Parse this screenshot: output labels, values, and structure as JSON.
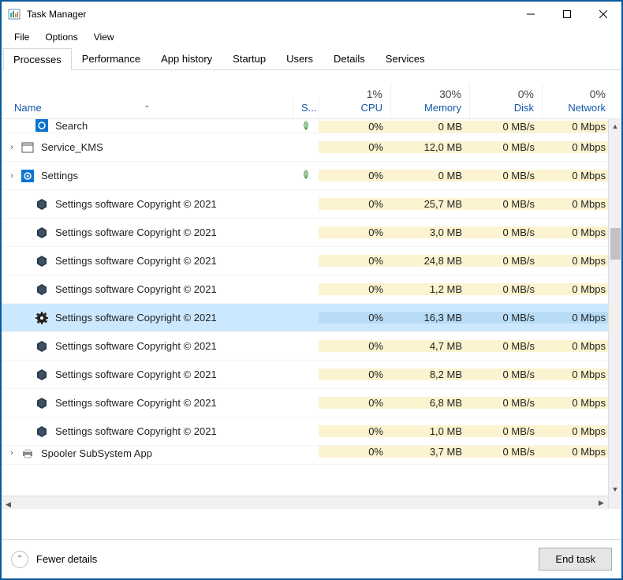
{
  "window": {
    "title": "Task Manager"
  },
  "menubar": [
    "File",
    "Options",
    "View"
  ],
  "tabs": [
    "Processes",
    "Performance",
    "App history",
    "Startup",
    "Users",
    "Details",
    "Services"
  ],
  "active_tab": 0,
  "columns": {
    "name": "Name",
    "status": "S...",
    "cpu_pct": "1%",
    "cpu": "CPU",
    "mem_pct": "30%",
    "mem": "Memory",
    "disk_pct": "0%",
    "disk": "Disk",
    "net_pct": "0%",
    "net": "Network"
  },
  "processes": [
    {
      "expand": "hidden",
      "indent": true,
      "icon": "blue-square",
      "name": "Search",
      "status": "leaf",
      "cpu": "0%",
      "mem": "0 MB",
      "disk": "0 MB/s",
      "net": "0 Mbps",
      "partial": "top"
    },
    {
      "expand": "closed",
      "indent": false,
      "icon": "window",
      "name": "Service_KMS",
      "status": "",
      "cpu": "0%",
      "mem": "12,0 MB",
      "disk": "0 MB/s",
      "net": "0 Mbps"
    },
    {
      "expand": "closed",
      "indent": false,
      "icon": "gear-blue",
      "name": "Settings",
      "status": "leaf",
      "cpu": "0%",
      "mem": "0 MB",
      "disk": "0 MB/s",
      "net": "0 Mbps"
    },
    {
      "expand": "none",
      "indent": true,
      "icon": "hex",
      "name": "Settings software Copyright © 2021",
      "status": "",
      "cpu": "0%",
      "mem": "25,7 MB",
      "disk": "0 MB/s",
      "net": "0 Mbps"
    },
    {
      "expand": "none",
      "indent": true,
      "icon": "hex",
      "name": "Settings software Copyright © 2021",
      "status": "",
      "cpu": "0%",
      "mem": "3,0 MB",
      "disk": "0 MB/s",
      "net": "0 Mbps"
    },
    {
      "expand": "none",
      "indent": true,
      "icon": "hex",
      "name": "Settings software Copyright © 2021",
      "status": "",
      "cpu": "0%",
      "mem": "24,8 MB",
      "disk": "0 MB/s",
      "net": "0 Mbps"
    },
    {
      "expand": "none",
      "indent": true,
      "icon": "hex",
      "name": "Settings software Copyright © 2021",
      "status": "",
      "cpu": "0%",
      "mem": "1,2 MB",
      "disk": "0 MB/s",
      "net": "0 Mbps"
    },
    {
      "expand": "none",
      "indent": true,
      "icon": "gear-black",
      "name": "Settings software Copyright © 2021",
      "status": "",
      "cpu": "0%",
      "mem": "16,3 MB",
      "disk": "0 MB/s",
      "net": "0 Mbps",
      "selected": true
    },
    {
      "expand": "none",
      "indent": true,
      "icon": "hex",
      "name": "Settings software Copyright © 2021",
      "status": "",
      "cpu": "0%",
      "mem": "4,7 MB",
      "disk": "0 MB/s",
      "net": "0 Mbps"
    },
    {
      "expand": "none",
      "indent": true,
      "icon": "hex",
      "name": "Settings software Copyright © 2021",
      "status": "",
      "cpu": "0%",
      "mem": "8,2 MB",
      "disk": "0 MB/s",
      "net": "0 Mbps"
    },
    {
      "expand": "none",
      "indent": true,
      "icon": "hex",
      "name": "Settings software Copyright © 2021",
      "status": "",
      "cpu": "0%",
      "mem": "6,8 MB",
      "disk": "0 MB/s",
      "net": "0 Mbps"
    },
    {
      "expand": "none",
      "indent": true,
      "icon": "hex",
      "name": "Settings software Copyright © 2021",
      "status": "",
      "cpu": "0%",
      "mem": "1,0 MB",
      "disk": "0 MB/s",
      "net": "0 Mbps"
    },
    {
      "expand": "closed",
      "indent": false,
      "icon": "printer",
      "name": "Spooler SubSystem App",
      "status": "",
      "cpu": "0%",
      "mem": "3,7 MB",
      "disk": "0 MB/s",
      "net": "0 Mbps",
      "partial": "bot"
    }
  ],
  "footer": {
    "fewer": "Fewer details",
    "end_task": "End task"
  }
}
